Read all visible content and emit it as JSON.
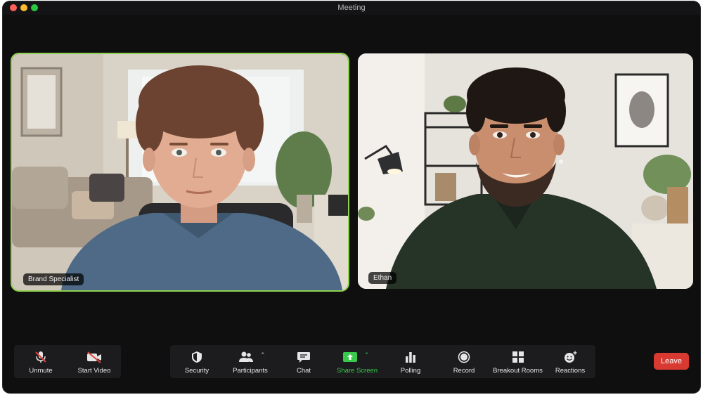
{
  "window": {
    "title": "Meeting"
  },
  "participants": [
    {
      "name": "Brand Specialist",
      "active_speaker": true
    },
    {
      "name": "Ethan",
      "active_speaker": false
    }
  ],
  "toolbar": {
    "unmute": "Unmute",
    "start_video": "Start Video",
    "security": "Security",
    "participants": "Participants",
    "chat": "Chat",
    "share_screen": "Share Screen",
    "polling": "Polling",
    "record": "Record",
    "breakout_rooms": "Breakout Rooms",
    "reactions": "Reactions",
    "leave": "Leave"
  },
  "colors": {
    "active_speaker_border": "#8fd24f",
    "share_screen": "#39c94b",
    "leave": "#d83a32",
    "background": "#0f0f10"
  }
}
